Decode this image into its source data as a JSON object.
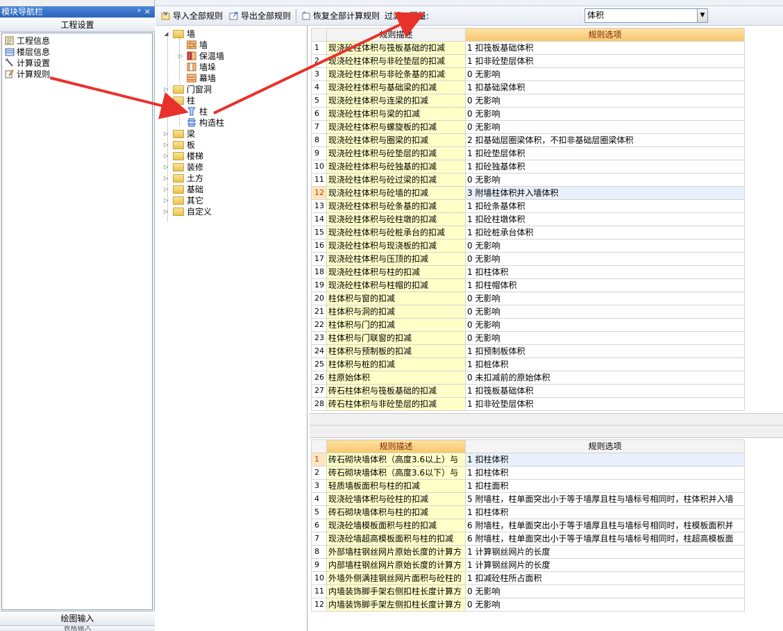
{
  "nav": {
    "title": "模块导航栏",
    "pin": "ᵖ",
    "close": "×",
    "section": "工程设置",
    "items": [
      {
        "label": "工程信息"
      },
      {
        "label": "楼层信息"
      },
      {
        "label": "计算设置"
      },
      {
        "label": "计算规则"
      }
    ],
    "bottom1": "绘图输入",
    "bottom2": "表格输入"
  },
  "toolbar": {
    "import": "导入全部规则",
    "export": "导出全部规则",
    "restore": "恢复全部计算规则",
    "filter_label": "过滤工程量:",
    "filter_value": "体积",
    "dropdown": "▼"
  },
  "tree": {
    "nodes": [
      {
        "label": "墙",
        "exp": "◢",
        "level": 0
      },
      {
        "label": "墙",
        "level": 1
      },
      {
        "label": "保温墙",
        "exp": "▷",
        "level": 1
      },
      {
        "label": "墙垛",
        "level": 1
      },
      {
        "label": "幕墙",
        "level": 1
      },
      {
        "label": "门窗洞",
        "exp": "▷",
        "level": 0
      },
      {
        "label": "柱",
        "exp": "◢",
        "level": 0
      },
      {
        "label": "柱",
        "level": 1
      },
      {
        "label": "构造柱",
        "level": 1
      },
      {
        "label": "梁",
        "exp": "▷",
        "level": 0
      },
      {
        "label": "板",
        "exp": "▷",
        "level": 0
      },
      {
        "label": "楼梯",
        "exp": "▷",
        "level": 0
      },
      {
        "label": "装修",
        "exp": "▷",
        "level": 0
      },
      {
        "label": "土方",
        "exp": "▷",
        "level": 0
      },
      {
        "label": "基础",
        "exp": "▷",
        "level": 0
      },
      {
        "label": "其它",
        "exp": "▷",
        "level": 0
      },
      {
        "label": "自定义",
        "exp": "▷",
        "level": 0
      }
    ]
  },
  "upper_grid": {
    "headers": [
      "规则描述",
      "规则选项"
    ],
    "rows": [
      {
        "n": "1",
        "desc": "现浇砼柱体积与筏板基础的扣减",
        "opt": "1 扣筏板基础体积"
      },
      {
        "n": "2",
        "desc": "现浇砼柱体积与非砼垫层的扣减",
        "opt": "1 扣非砼垫层体积"
      },
      {
        "n": "3",
        "desc": "现浇砼柱体积与非砼条基的扣减",
        "opt": "0  无影响"
      },
      {
        "n": "4",
        "desc": "现浇砼柱体积与基础梁的扣减",
        "opt": "1 扣基础梁体积"
      },
      {
        "n": "5",
        "desc": "现浇砼柱体积与连梁的扣减",
        "opt": "0  无影响"
      },
      {
        "n": "6",
        "desc": "现浇砼柱体积与梁的扣减",
        "opt": "0  无影响"
      },
      {
        "n": "7",
        "desc": "现浇砼柱体积与螺旋板的扣减",
        "opt": "0  无影响"
      },
      {
        "n": "8",
        "desc": "现浇砼柱体积与圈梁的扣减",
        "opt": "2 扣基础层圈梁体积，不扣非基础层圈梁体积"
      },
      {
        "n": "9",
        "desc": "现浇砼柱体积与砼垫层的扣减",
        "opt": "1 扣砼垫层体积"
      },
      {
        "n": "10",
        "desc": "现浇砼柱体积与砼独基的扣减",
        "opt": "1 扣砼独基体积"
      },
      {
        "n": "11",
        "desc": "现浇砼柱体积与砼过梁的扣减",
        "opt": "0  无影响"
      },
      {
        "n": "12",
        "desc": "现浇砼柱体积与砼墙的扣减",
        "opt": "3 附墙柱体积并入墙体积"
      },
      {
        "n": "13",
        "desc": "现浇砼柱体积与砼条基的扣减",
        "opt": "1 扣砼条基体积"
      },
      {
        "n": "14",
        "desc": "现浇砼柱体积与砼柱墩的扣减",
        "opt": "1 扣砼柱墩体积"
      },
      {
        "n": "15",
        "desc": "现浇砼柱体积与砼桩承台的扣减",
        "opt": "1 扣砼桩承台体积"
      },
      {
        "n": "16",
        "desc": "现浇砼柱体积与现浇板的扣减",
        "opt": "0  无影响"
      },
      {
        "n": "17",
        "desc": "现浇砼柱体积与压顶的扣减",
        "opt": "0  无影响"
      },
      {
        "n": "18",
        "desc": "现浇砼柱体积与柱的扣减",
        "opt": "1 扣柱体积"
      },
      {
        "n": "19",
        "desc": "现浇砼柱体积与柱帽的扣减",
        "opt": "1 扣柱帽体积"
      },
      {
        "n": "20",
        "desc": "柱体积与窗的扣减",
        "opt": "0  无影响"
      },
      {
        "n": "21",
        "desc": "柱体积与洞的扣减",
        "opt": "0  无影响"
      },
      {
        "n": "22",
        "desc": "柱体积与门的扣减",
        "opt": "0  无影响"
      },
      {
        "n": "23",
        "desc": "柱体积与门联窗的扣减",
        "opt": "0  无影响"
      },
      {
        "n": "24",
        "desc": "柱体积与预制板的扣减",
        "opt": "1 扣预制板体积"
      },
      {
        "n": "25",
        "desc": "柱体积与桩的扣减",
        "opt": "1 扣桩体积"
      },
      {
        "n": "26",
        "desc": "柱原始体积",
        "opt": "0 未扣减前的原始体积"
      },
      {
        "n": "27",
        "desc": "砖石柱体积与筏板基础的扣减",
        "opt": "1 扣筏板基础体积"
      },
      {
        "n": "28",
        "desc": "砖石柱体积与非砼垫层的扣减",
        "opt": "1 扣非砼垫层体积"
      }
    ]
  },
  "lower_grid": {
    "headers": [
      "规则描述",
      "规则选项"
    ],
    "rows": [
      {
        "n": "1",
        "desc": "砖石砌块墙体积（高度3.6以上）与",
        "opt": "1  扣柱体积"
      },
      {
        "n": "2",
        "desc": "砖石砌块墙体积（高度3.6以下）与",
        "opt": "1  扣柱体积"
      },
      {
        "n": "3",
        "desc": "轻质墙板面积与柱的扣减",
        "opt": "1  扣柱面积"
      },
      {
        "n": "4",
        "desc": "现浇砼墙体积与砼柱的扣减",
        "opt": "5  附墙柱，柱单面突出小于等于墙厚且柱与墙标号相同时，柱体积并入墙"
      },
      {
        "n": "5",
        "desc": "砖石砌块墙体积与柱的扣减",
        "opt": "1  扣柱体积"
      },
      {
        "n": "6",
        "desc": "现浇砼墙模板面积与柱的扣减",
        "opt": "6  附墙柱，柱单面突出小于等于墙厚且柱与墙标号相同时，柱模板面积并"
      },
      {
        "n": "7",
        "desc": "现浇砼墙超高模板面积与柱的扣减",
        "opt": "6  附墙柱，柱单面突出小于等于墙厚且柱与墙标号相同时，柱超高模板面"
      },
      {
        "n": "8",
        "desc": "外部墙柱钢丝网片原始长度的计算方",
        "opt": "1  计算钢丝网片的长度"
      },
      {
        "n": "9",
        "desc": "内部墙柱钢丝网片原始长度的计算方",
        "opt": "1  计算钢丝网片的长度"
      },
      {
        "n": "10",
        "desc": "外墙外侧满挂钢丝网片面积与砼柱的",
        "opt": "1  扣减砼柱所占面积"
      },
      {
        "n": "11",
        "desc": "内墙装饰脚手架右侧扣柱长度计算方",
        "opt": "0  无影响"
      },
      {
        "n": "12",
        "desc": "内墙装饰脚手架左侧扣柱长度计算方",
        "opt": "0  无影响"
      }
    ]
  },
  "colors": {
    "arrow": "#e8312a",
    "desc_bg": "#ffffc8",
    "header_hl": "#f7c76a",
    "nav_title": "#2a64b8"
  }
}
